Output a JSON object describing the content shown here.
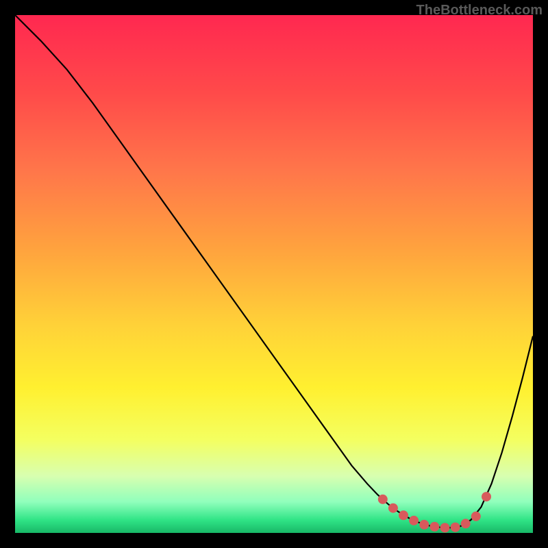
{
  "watermark": "TheBottleneck.com",
  "chart_data": {
    "type": "line",
    "title": "",
    "xlabel": "",
    "ylabel": "",
    "xlim": [
      0,
      100
    ],
    "ylim": [
      0,
      100
    ],
    "series": [
      {
        "name": "curve",
        "x": [
          0,
          5,
          10,
          15,
          20,
          25,
          30,
          35,
          40,
          45,
          50,
          55,
          60,
          65,
          68,
          70,
          72,
          74,
          76,
          78,
          80,
          82,
          84,
          86,
          88,
          90,
          92,
          94,
          96,
          98,
          100
        ],
        "values": [
          100,
          95,
          89.5,
          83,
          76,
          69,
          62,
          55,
          48,
          41,
          34,
          27,
          20,
          13,
          9.5,
          7.4,
          5.6,
          4.1,
          2.9,
          2.0,
          1.4,
          1.1,
          1.0,
          1.3,
          2.5,
          5.0,
          9.5,
          15.5,
          22.5,
          30.0,
          38.0
        ]
      },
      {
        "name": "markers",
        "x": [
          71,
          73,
          75,
          77,
          79,
          81,
          83,
          85,
          87,
          89,
          91
        ],
        "values": [
          6.5,
          4.8,
          3.4,
          2.4,
          1.6,
          1.2,
          1.0,
          1.1,
          1.8,
          3.2,
          7.0
        ]
      }
    ],
    "gradient_stops": [
      {
        "offset": 0.0,
        "color": "#ff2850"
      },
      {
        "offset": 0.15,
        "color": "#ff4a4a"
      },
      {
        "offset": 0.3,
        "color": "#ff764a"
      },
      {
        "offset": 0.45,
        "color": "#ffa23e"
      },
      {
        "offset": 0.6,
        "color": "#ffd238"
      },
      {
        "offset": 0.72,
        "color": "#fff030"
      },
      {
        "offset": 0.82,
        "color": "#f4ff60"
      },
      {
        "offset": 0.89,
        "color": "#d8ffb0"
      },
      {
        "offset": 0.94,
        "color": "#90ffbc"
      },
      {
        "offset": 0.975,
        "color": "#30e486"
      },
      {
        "offset": 1.0,
        "color": "#18b867"
      }
    ]
  }
}
